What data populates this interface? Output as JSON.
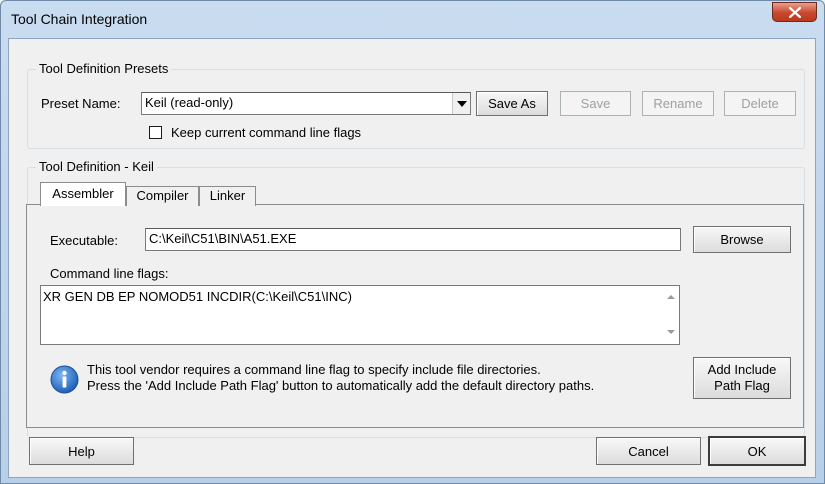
{
  "window": {
    "title": "Tool Chain Integration"
  },
  "presets": {
    "group_title": "Tool Definition Presets",
    "preset_label": "Preset Name:",
    "preset_value": "Keil (read-only)",
    "save_as": "Save As",
    "save": "Save",
    "rename": "Rename",
    "delete": "Delete",
    "keep_flags_label": "Keep current command line flags",
    "keep_flags_checked": false
  },
  "definition": {
    "group_title": "Tool Definition - Keil",
    "tabs": [
      {
        "label": "Assembler",
        "active": true
      },
      {
        "label": "Compiler",
        "active": false
      },
      {
        "label": "Linker",
        "active": false
      }
    ],
    "executable_label": "Executable:",
    "executable_value": "C:\\Keil\\C51\\BIN\\A51.EXE",
    "browse": "Browse",
    "flags_label": "Command line flags:",
    "flags_value": "XR GEN DB EP NOMOD51 INCDIR(C:\\Keil\\C51\\INC)",
    "info_line1": "This tool vendor requires a command line flag to specify include file directories.",
    "info_line2": "Press the 'Add Include Path Flag' button to automatically add the default directory paths.",
    "add_include_line1": "Add Include",
    "add_include_line2": "Path Flag"
  },
  "footer": {
    "help": "Help",
    "cancel": "Cancel",
    "ok": "OK"
  },
  "icons": {
    "close": "close-icon",
    "info": "info-icon",
    "dropdown": "chevron-down-icon"
  },
  "colors": {
    "close_button": "#c9472d",
    "info_icon": "#1f5fb8",
    "titlebar": "#c9dcf0"
  }
}
